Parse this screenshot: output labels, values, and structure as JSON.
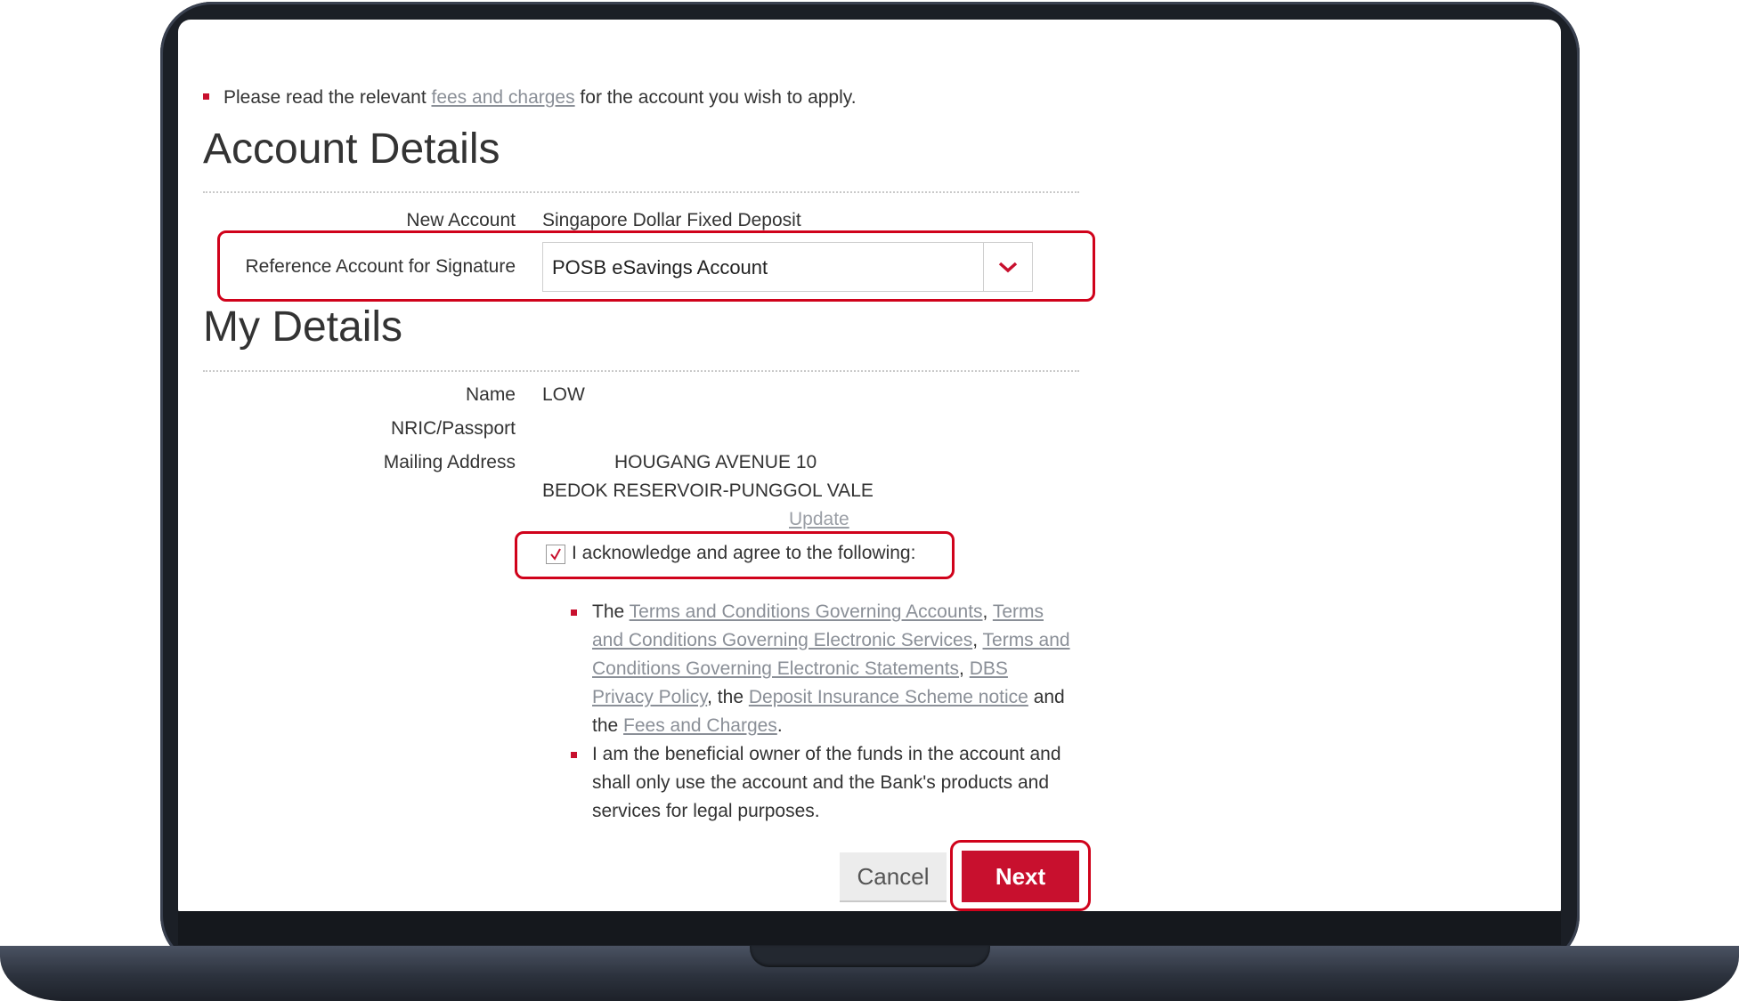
{
  "notice": {
    "prefix": "Please read the relevant ",
    "link": "fees and charges",
    "suffix": " for the account you wish to apply."
  },
  "account_details": {
    "title": "Account Details",
    "new_account_label": "New Account",
    "new_account_value": "Singapore Dollar Fixed Deposit",
    "reference_label": "Reference Account for Signature",
    "reference_selected": "POSB eSavings Account"
  },
  "my_details": {
    "title": "My Details",
    "name_label": "Name",
    "name_value": "LOW",
    "nric_label": "NRIC/Passport",
    "nric_value": "",
    "address_label": "Mailing Address",
    "address_line1": "HOUGANG AVENUE 10",
    "address_line2": "BEDOK RESERVOIR-PUNGGOL VALE",
    "update_link": "Update"
  },
  "acknowledge": {
    "checked": true,
    "label": "I acknowledge and agree to the following:"
  },
  "terms": {
    "item1": {
      "the": "The ",
      "link1": "Terms and Conditions Governing Accounts",
      "sep1": ", ",
      "link2": "Terms and Conditions Governing Electronic Services",
      "sep2": ", ",
      "link3": "Terms and Conditions Governing Electronic Statements",
      "sep3": ", ",
      "link4": "DBS Privacy Policy",
      "sep4": ", the ",
      "link5": "Deposit Insurance Scheme notice",
      "sep5": " and the ",
      "link6": "Fees and Charges",
      "end": "."
    },
    "item2": "I am the beneficial owner of the funds in the account and shall only use the account and the Bank's products and services for legal purposes."
  },
  "buttons": {
    "cancel": "Cancel",
    "next": "Next"
  },
  "colors": {
    "accent": "#c8102e",
    "highlight": "#d0021b",
    "link": "#8a8f97"
  }
}
